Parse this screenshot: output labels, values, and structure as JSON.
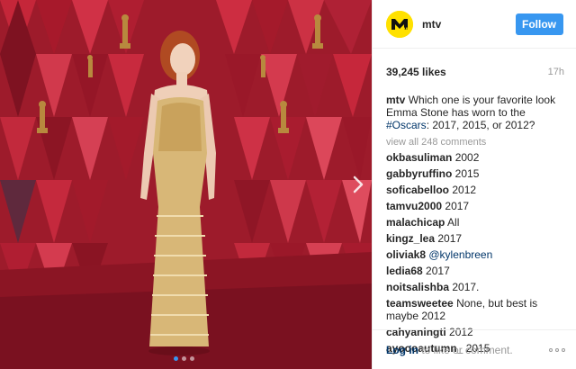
{
  "post": {
    "account": "mtv",
    "logo_text": "M",
    "follow_label": "Follow",
    "likes": "39,245 likes",
    "age": "17h",
    "caption": {
      "user": "mtv",
      "text_before": "Which one is your favorite look Emma Stone has worn to the ",
      "hashtag": "#Oscars",
      "text_after": ": 2017, 2015, or 2012?"
    },
    "view_all": "view all 248 comments",
    "comments": [
      {
        "user": "okbasuliman",
        "text": "2002"
      },
      {
        "user": "gabbyruffino",
        "text": "2015"
      },
      {
        "user": "soficabelloo",
        "text": "2012"
      },
      {
        "user": "tamvu2000",
        "text": "2017"
      },
      {
        "user": "malachicap",
        "text": "All"
      },
      {
        "user": "kingz_lea",
        "text": "2017"
      },
      {
        "user": "oliviak8",
        "text": "",
        "mention": "@kylenbreen"
      },
      {
        "user": "ledia68",
        "text": "2017"
      },
      {
        "user": "noitsalishba",
        "text": "2017."
      },
      {
        "user": "teamsweetee",
        "text": "None, but best is maybe 2012"
      },
      {
        "user": "cahyaningti",
        "text": "2012"
      },
      {
        "user": "ayoooautumn_",
        "text": "2015"
      }
    ],
    "login_link": "Log in",
    "login_rest": " to like or comment."
  },
  "carousel": {
    "total": 3,
    "active": 0
  },
  "icons": {
    "next": "chevron-right-icon",
    "more": "more-options-icon",
    "logo": "mtv-logo-icon"
  },
  "colors": {
    "accent": "#3897f0",
    "link": "#003569",
    "muted": "#999999",
    "logo_bg": "#ffe100"
  }
}
